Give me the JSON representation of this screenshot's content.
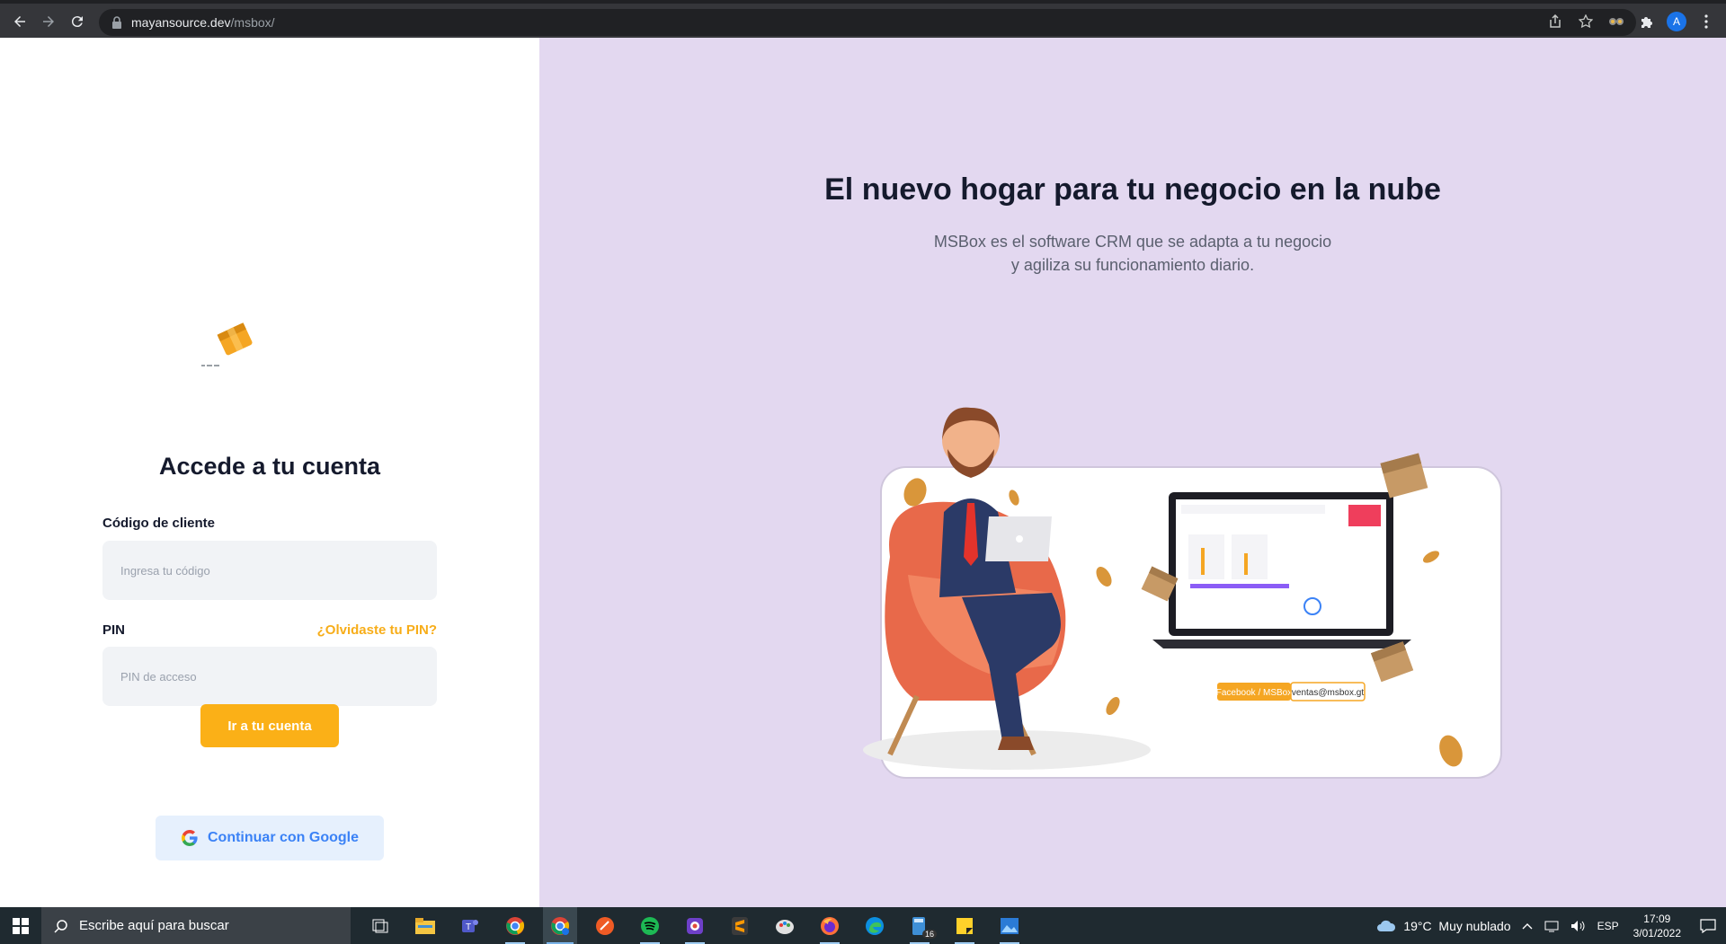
{
  "browser": {
    "url_host": "mayansource.dev",
    "url_path": "/msbox/",
    "profile_initial": "A"
  },
  "login": {
    "title": "Accede a tu cuenta",
    "client_code_label": "Código de cliente",
    "client_code_placeholder": "Ingresa tu código",
    "pin_label": "PIN",
    "forgot_pin": "¿Olvidaste tu PIN?",
    "pin_placeholder": "PIN de acceso",
    "submit_label": "Ir a tu cuenta",
    "google_label": "Continuar con Google"
  },
  "hero": {
    "title": "El nuevo hogar para tu negocio en la nube",
    "subtitle_line1": "MSBox es el software CRM que se adapta a tu negocio",
    "subtitle_line2": "y agiliza su funcionamiento diario.",
    "badge_left": "Facebook / MSBox",
    "badge_right": "ventas@msbox.gt"
  },
  "taskbar": {
    "search_placeholder": "Escribe aquí para buscar",
    "weather": "19°C  Muy nublado",
    "language": "ESP",
    "time": "17:09",
    "date": "3/01/2022",
    "badge_count": "16"
  },
  "colors": {
    "accent": "#fbb017",
    "hero_bg": "#e3d8f0",
    "google_text": "#3b82f6"
  }
}
